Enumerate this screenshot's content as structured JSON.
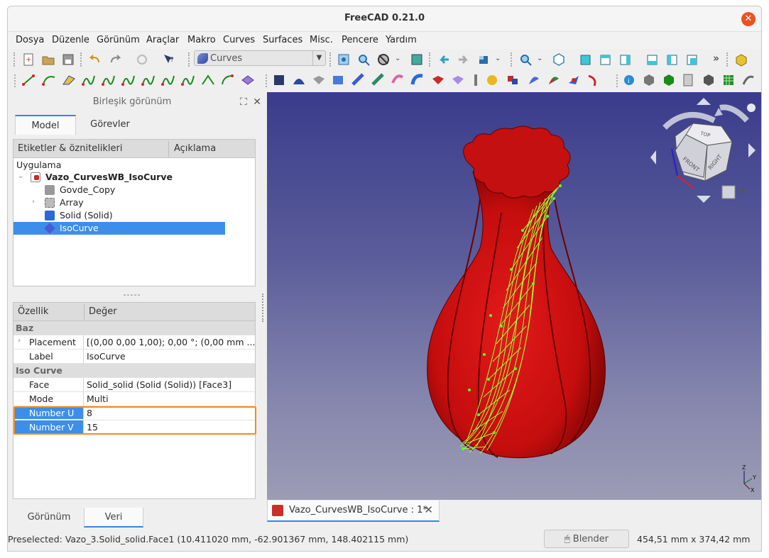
{
  "window": {
    "title": "FreeCAD 0.21.0"
  },
  "menu": [
    "Dosya",
    "Düzenle",
    "Görünüm",
    "Araçlar",
    "Makro",
    "Curves",
    "Surfaces",
    "Misc.",
    "Pencere",
    "Yardım"
  ],
  "toolbar": {
    "workbench": "Curves",
    "more": "»"
  },
  "combo_view": {
    "title": "Birleşik görünüm",
    "tabs": [
      "Model",
      "Görevler"
    ],
    "tree_headers": [
      "Etiketler & öznitelikleri",
      "Açıklama"
    ],
    "tree": {
      "root": "Uygulama",
      "doc": "Vazo_CurvesWB_IsoCurve",
      "items": [
        "Govde_Copy",
        "Array",
        "Solid (Solid)",
        "IsoCurve"
      ]
    },
    "splitter": "-----",
    "prop_headers": [
      "Özellik",
      "Değer"
    ],
    "groups": [
      "Baz",
      "Iso Curve"
    ],
    "props": {
      "placement": {
        "k": "Placement",
        "v": "[(0,00 0,00 1,00); 0,00 °; (0,00 mm  ..."
      },
      "label": {
        "k": "Label",
        "v": "IsoCurve"
      },
      "face": {
        "k": "Face",
        "v": "Solid_solid (Solid (Solid)) [Face3]"
      },
      "mode": {
        "k": "Mode",
        "v": "Multi"
      },
      "number_u": {
        "k": "Number U",
        "v": "8"
      },
      "number_v": {
        "k": "Number V",
        "v": "15"
      }
    },
    "bottom_tabs": [
      "Görünüm",
      "Veri"
    ]
  },
  "document_tab": {
    "title": "Vazo_CurvesWB_IsoCurve : 1*"
  },
  "status": {
    "preselected": "Preselected: Vazo_3.Solid_solid.Face1 (10.411020 mm, -62.901367 mm, 148.402115 mm)",
    "nav_style": "Blender",
    "dimensions": "454,51 mm x 374,42 mm"
  },
  "navcube": {
    "faces": [
      "TOP",
      "FRONT",
      "RIGHT"
    ]
  },
  "axis_labels": [
    "Z",
    "Y",
    "X"
  ],
  "colors": {
    "accent": "#3584e4",
    "highlight": "#f28c1b",
    "vase": "#d41010",
    "isocurve": "#9dff3a"
  }
}
